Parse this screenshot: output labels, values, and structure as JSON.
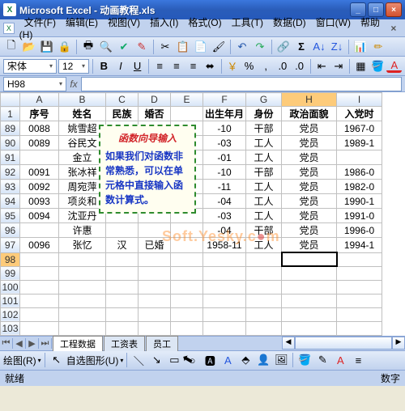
{
  "app": {
    "title": "Microsoft Excel - 动画教程.xls"
  },
  "menus": [
    "文件(F)",
    "编辑(E)",
    "视图(V)",
    "插入(I)",
    "格式(O)",
    "工具(T)",
    "数据(D)",
    "窗口(W)",
    "帮助(H)"
  ],
  "font": {
    "name": "宋体",
    "size": "12"
  },
  "namebox": "H98",
  "columns": [
    "A",
    "B",
    "C",
    "D",
    "E",
    "F",
    "G",
    "H",
    "I"
  ],
  "header_row": {
    "num": "1",
    "cells": [
      "序号",
      "姓名",
      "民族",
      "婚否",
      "出生年月",
      "身份",
      "政治面貌",
      "入党时"
    ]
  },
  "rows": [
    {
      "num": "89",
      "A": "0088",
      "B": "姚雪超",
      "F": "-10",
      "G": "干部",
      "H": "党员",
      "I": "1967-0"
    },
    {
      "num": "90",
      "A": "0089",
      "B": "谷民文",
      "F": "-03",
      "G": "工人",
      "H": "党员",
      "I": "1989-1"
    },
    {
      "num": "91",
      "A": "",
      "B": "金立",
      "F": "-01",
      "G": "工人",
      "H": "党员",
      "I": ""
    },
    {
      "num": "92",
      "A": "0091",
      "B": "张冰祥",
      "F": "-10",
      "G": "干部",
      "H": "党员",
      "I": "1986-0"
    },
    {
      "num": "93",
      "A": "0092",
      "B": "周宛萍",
      "F": "-11",
      "G": "工人",
      "H": "党员",
      "I": "1982-0"
    },
    {
      "num": "94",
      "A": "0093",
      "B": "项炎和",
      "F": "-04",
      "G": "工人",
      "H": "党员",
      "I": "1990-1"
    },
    {
      "num": "95",
      "A": "0094",
      "B": "沈亚丹",
      "F": "-03",
      "G": "工人",
      "H": "党员",
      "I": "1991-0"
    },
    {
      "num": "96",
      "A": "",
      "B": "许惠",
      "F": "-04",
      "G": "干部",
      "H": "党员",
      "I": "1996-0"
    },
    {
      "num": "97",
      "A": "0096",
      "B": "张忆",
      "C": "汉",
      "D": "已婚",
      "F": "1958-11",
      "G": "工人",
      "H": "党员",
      "I": "1994-1"
    }
  ],
  "empty_rows": [
    "98",
    "99",
    "100",
    "101",
    "102",
    "103"
  ],
  "callout": {
    "title": "函数向导输入",
    "body": "如果我们对函数非常熟悉，可以在单元格中直接输入函数计算式。"
  },
  "watermark": {
    "a": "Soft.Yesky.c",
    "b": "●",
    "c": "m"
  },
  "sheets": {
    "active": "工程数据",
    "others": [
      "工资表",
      "员工"
    ]
  },
  "drawbar": {
    "label1": "绘图(R)",
    "label2": "自选图形(U)"
  },
  "status": {
    "left": "就绪",
    "right": "数字"
  }
}
